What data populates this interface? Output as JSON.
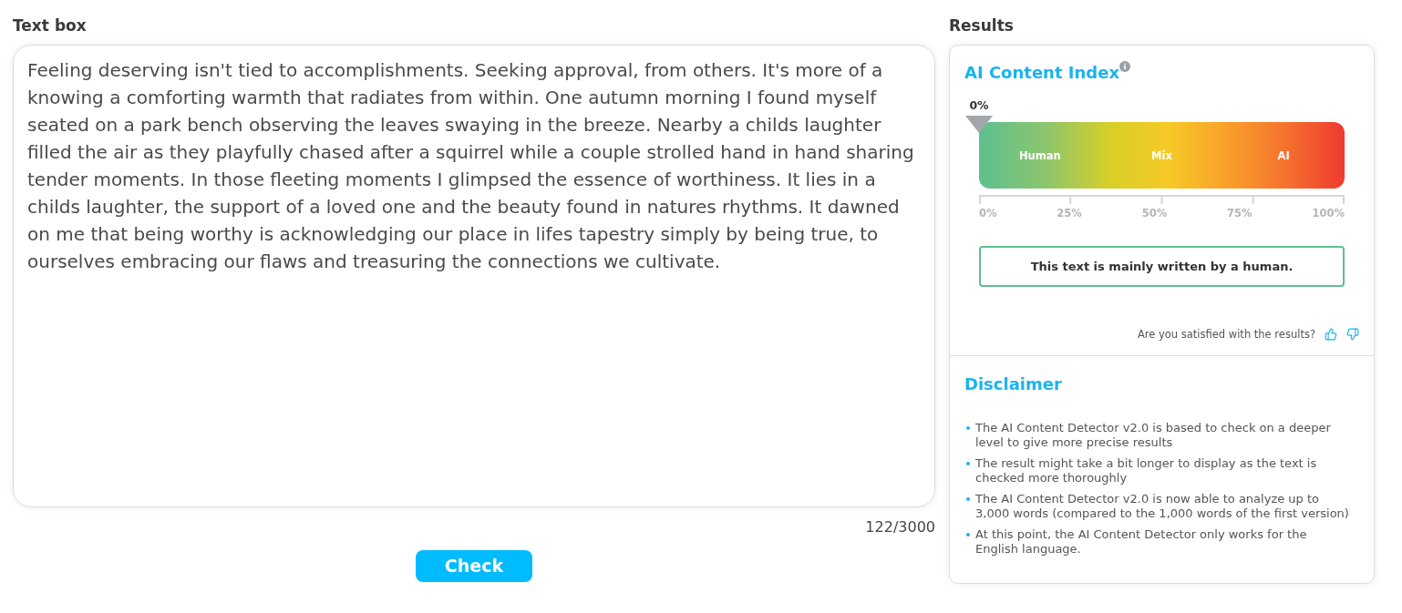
{
  "text_box": {
    "label": "Text box",
    "value": "Feeling deserving isn't tied to accomplishments. Seeking approval, from others. It's more of a knowing a comforting warmth that radiates from within. One autumn morning I found myself seated on a park bench observing the leaves swaying in the breeze. Nearby a childs laughter filled the air as they playfully chased after a squirrel while a couple strolled hand in hand sharing tender moments. In those fleeting moments I glimpsed the essence of worthiness. It lies in a childs laughter, the support of a loved one and the beauty found in natures rhythms. It dawned on me that being worthy is acknowledging our place in lifes tapestry simply by being true, to ourselves embracing our flaws and treasuring the connections we cultivate.",
    "counter": "122/3000"
  },
  "check_button": {
    "label": "Check"
  },
  "results": {
    "title": "Results",
    "index": {
      "title": "AI Content Index",
      "reading": "0%",
      "level": 0,
      "segments": [
        "Human",
        "Mix",
        "AI"
      ],
      "ticks": [
        "0%",
        "25%",
        "50%",
        "75%",
        "100%"
      ],
      "verdict": "This text is mainly written by a human.",
      "feedback": "Are you satisfied with the results?"
    },
    "disclaimer": {
      "title": "Disclaimer",
      "items": [
        "The AI Content Detector v2.0 is based to check on a deeper level to give more precise results",
        "The result might take a bit longer to display as the text is checked more thoroughly",
        "The AI Content Detector v2.0 is now able to analyze up to 3,000 words (compared to the 1,000 words of the first version)",
        "At this point, the AI Content Detector only works for the English language."
      ]
    }
  }
}
